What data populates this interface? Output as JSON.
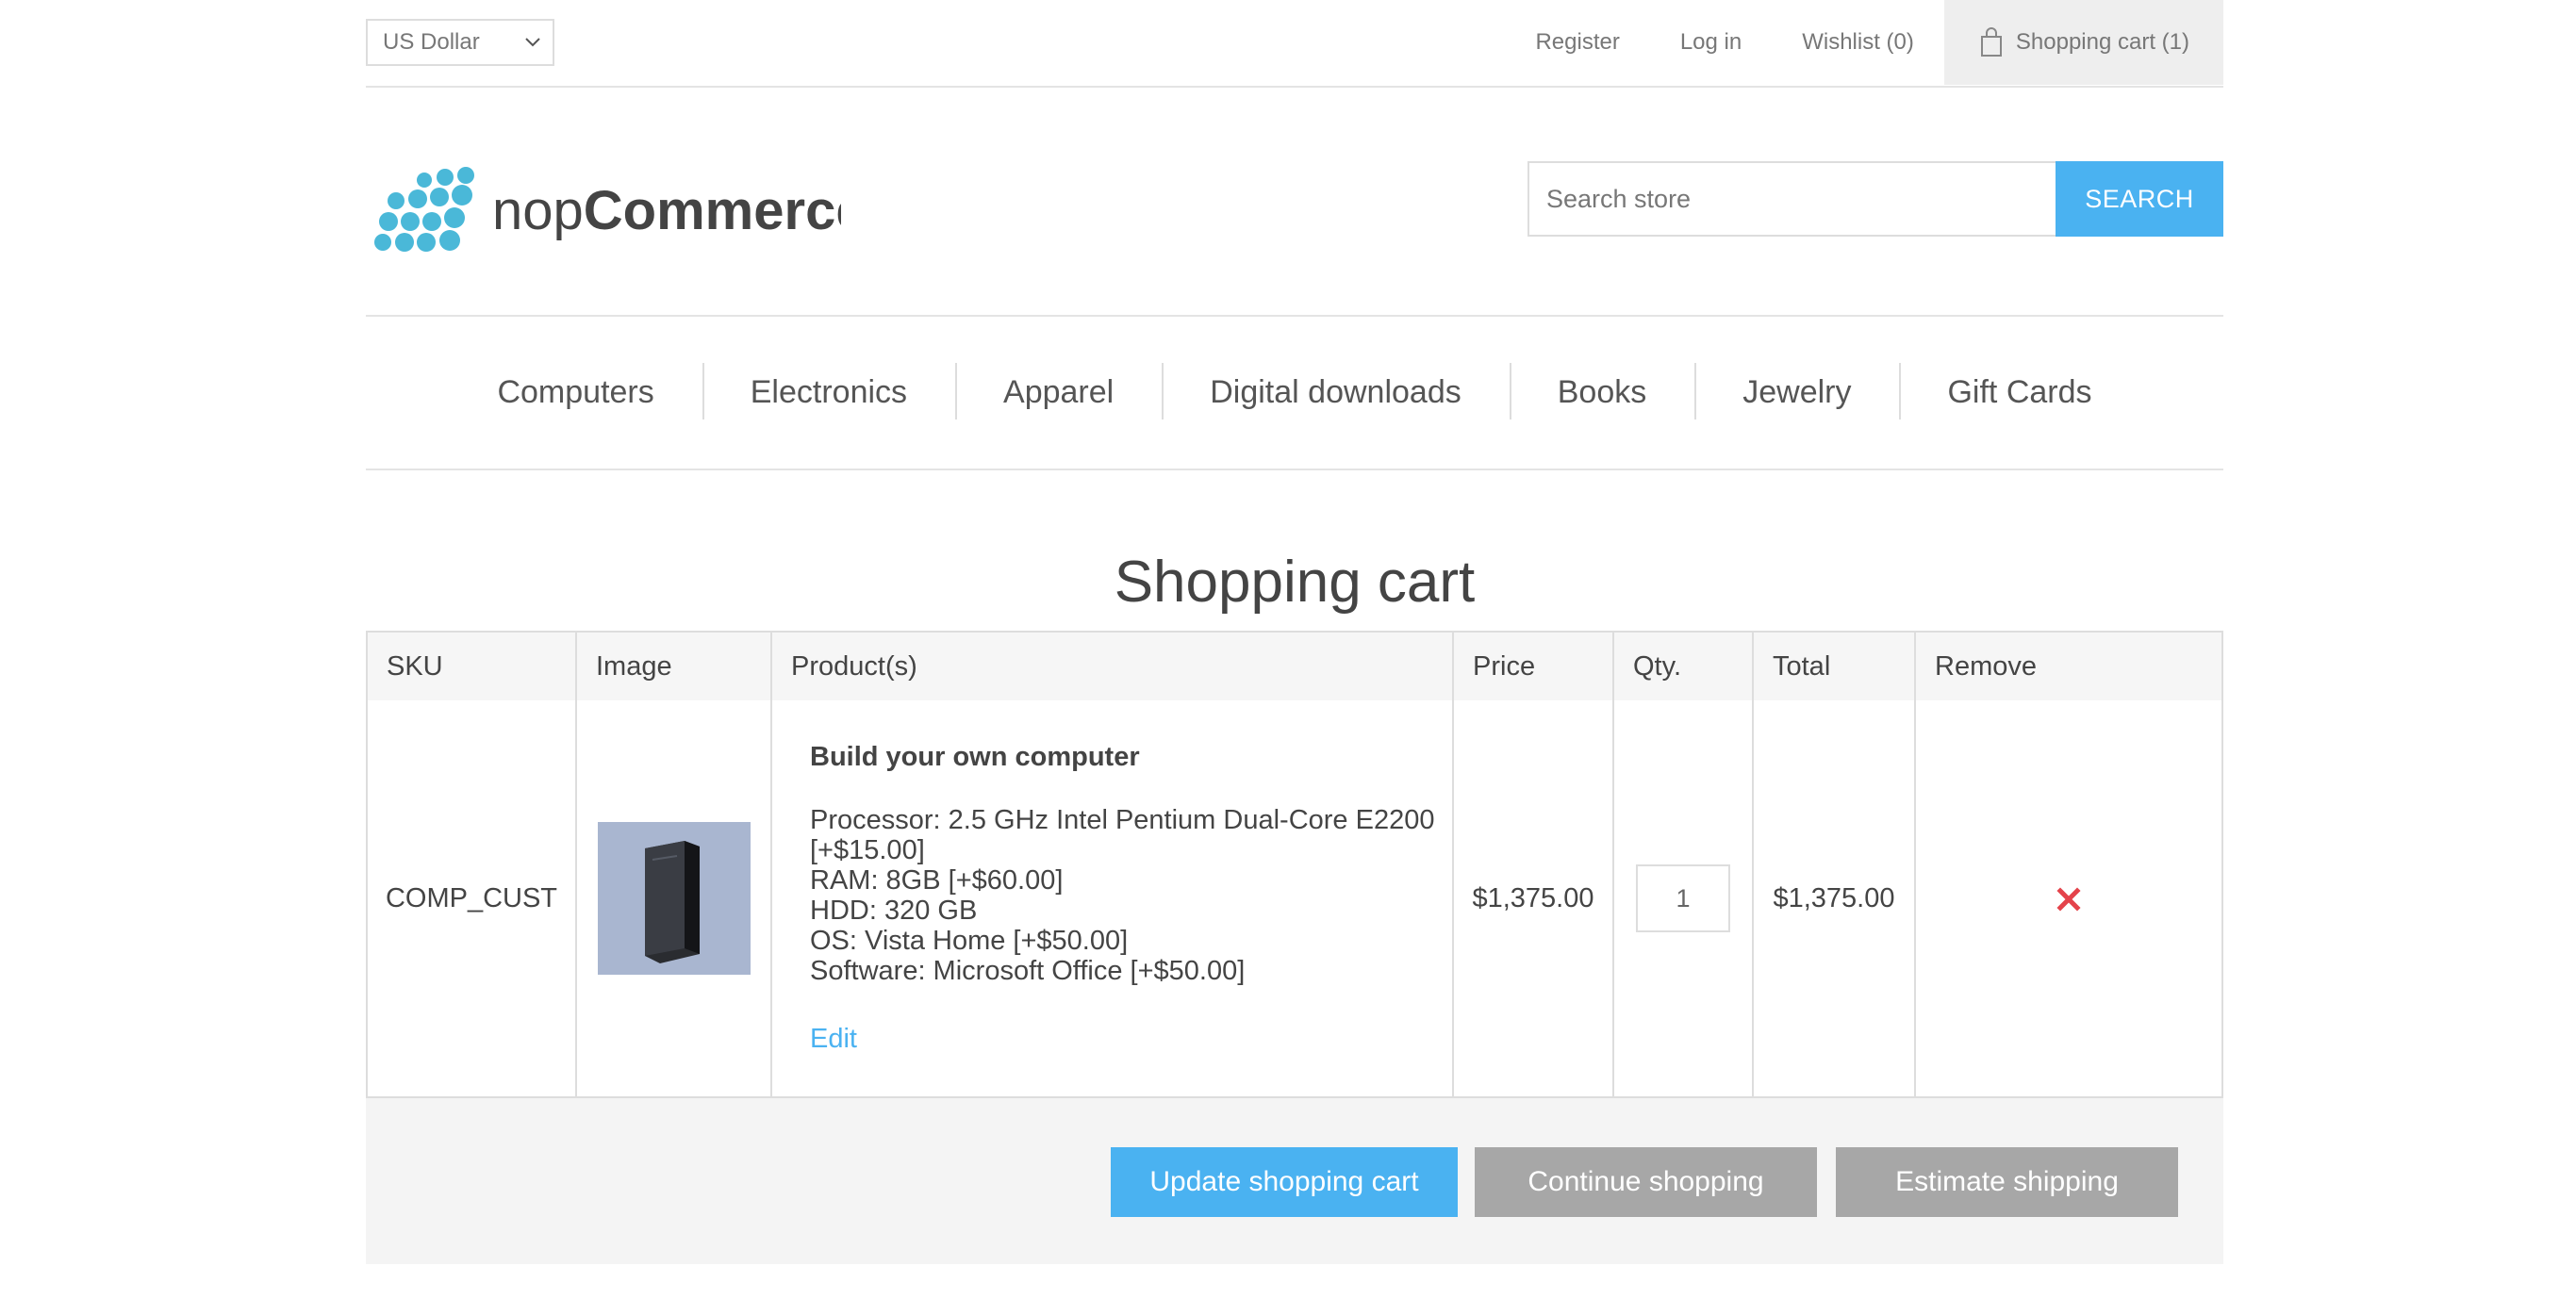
{
  "header": {
    "currency": "US Dollar",
    "links": {
      "register": "Register",
      "login": "Log in",
      "wishlist": "Wishlist (0)",
      "cart": "Shopping cart (1)"
    }
  },
  "logo": {
    "prefix": "nop",
    "suffix": "Commerce"
  },
  "search": {
    "placeholder": "Search store",
    "button": "SEARCH"
  },
  "nav": [
    "Computers",
    "Electronics",
    "Apparel",
    "Digital downloads",
    "Books",
    "Jewelry",
    "Gift Cards"
  ],
  "page": {
    "title": "Shopping cart"
  },
  "table": {
    "headers": [
      "SKU",
      "Image",
      "Product(s)",
      "Price",
      "Qty.",
      "Total",
      "Remove"
    ],
    "rows": [
      {
        "sku": "COMP_CUST",
        "name": "Build your own computer",
        "attributes": [
          "Processor: 2.5 GHz Intel Pentium Dual-Core E2200 [+$15.00]",
          "RAM: 8GB [+$60.00]",
          "HDD: 320 GB",
          "OS: Vista Home [+$50.00]",
          "Software: Microsoft Office [+$50.00]"
        ],
        "edit": "Edit",
        "price": "$1,375.00",
        "qty": "1",
        "total": "$1,375.00"
      }
    ]
  },
  "buttons": {
    "update": "Update shopping cart",
    "continue": "Continue shopping",
    "estimate": "Estimate shipping"
  },
  "colors": {
    "accent": "#4ab2f1",
    "remove": "#e4434b",
    "secondary_button": "#a7a7a7",
    "logo_dots": "#4ab8d8"
  }
}
